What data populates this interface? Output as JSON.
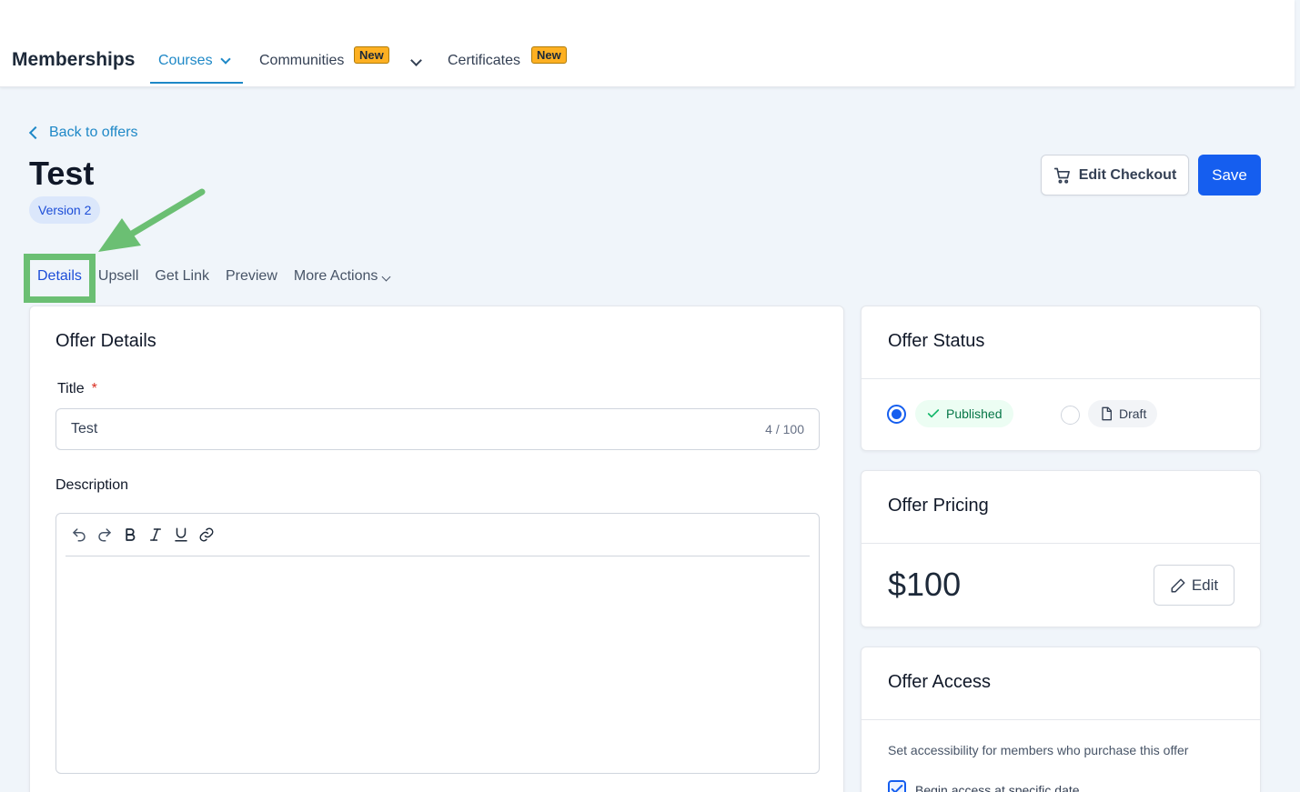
{
  "nav": {
    "brand": "Memberships",
    "tabs": [
      {
        "label": "Courses",
        "active": true
      },
      {
        "label": "Communities",
        "badge": "New"
      },
      {
        "label": "Certificates",
        "badge": "New"
      }
    ]
  },
  "header": {
    "back_label": "Back to offers",
    "title": "Test",
    "version": "Version 2",
    "edit_checkout_label": "Edit Checkout",
    "save_label": "Save"
  },
  "tabs": [
    "Details",
    "Upsell",
    "Get Link",
    "Preview",
    "More Actions"
  ],
  "offer_details": {
    "heading": "Offer Details",
    "title_label": "Title",
    "required_mark": "*",
    "title_value": "Test",
    "title_counter": "4 / 100",
    "description_label": "Description"
  },
  "offer_status": {
    "heading": "Offer Status",
    "published_label": "Published",
    "draft_label": "Draft",
    "selected": "Published"
  },
  "offer_pricing": {
    "heading": "Offer Pricing",
    "price": "$100",
    "edit_label": "Edit"
  },
  "offer_access": {
    "heading": "Offer Access",
    "description": "Set accessibility for members who purchase this offer",
    "checkbox_label": "Begin access at specific date",
    "checked": true
  },
  "colors": {
    "primary": "#155eef",
    "link": "#1e88c7",
    "highlight": "#6bbf73",
    "badge": "#fdb022"
  }
}
